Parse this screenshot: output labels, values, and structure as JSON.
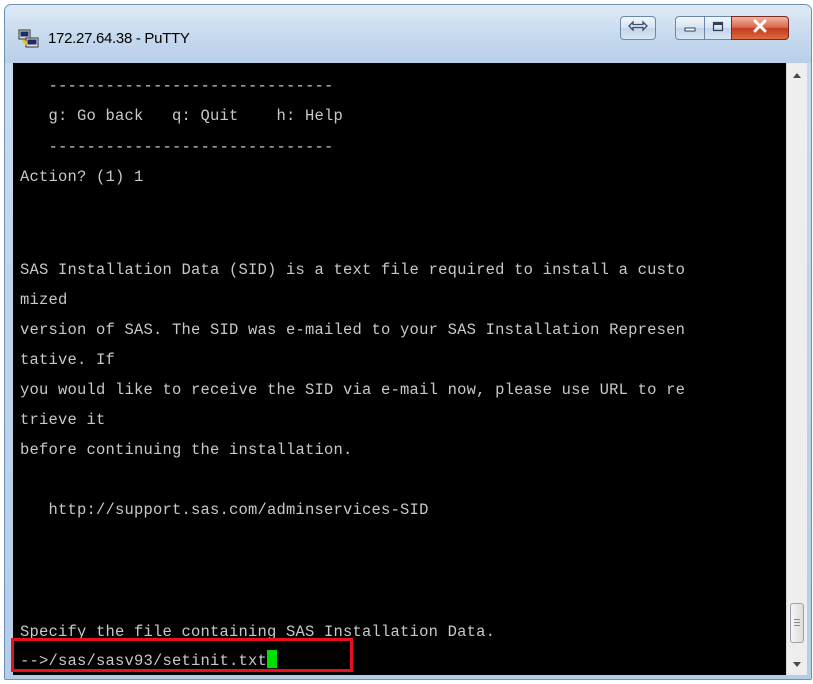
{
  "window": {
    "title": "172.27.64.38 - PuTTY"
  },
  "icons": {
    "app": "putty-icon",
    "switch": "switch-arrows-icon",
    "minimize": "minimize-icon",
    "maximize": "maximize-icon",
    "close": "close-icon"
  },
  "colors": {
    "terminal_bg": "#000000",
    "terminal_fg": "#c8c8c8",
    "cursor": "#00e000",
    "highlight": "#e8101a"
  },
  "terminal": {
    "lines": [
      "   ------------------------------",
      "   g: Go back   q: Quit    h: Help",
      "   ------------------------------",
      "Action? (1) 1",
      "",
      "",
      "SAS Installation Data (SID) is a text file required to install a custo",
      "mized",
      "version of SAS. The SID was e-mailed to your SAS Installation Represen",
      "tative. If",
      "you would like to receive the SID via e-mail now, please use URL to re",
      "trieve it",
      "before continuing the installation.",
      "",
      "   http://support.sas.com/adminservices-SID",
      "",
      "",
      "",
      "",
      "Specify the file containing SAS Installation Data."
    ],
    "prompt": "-->/sas/sasv93/setinit.txt"
  }
}
